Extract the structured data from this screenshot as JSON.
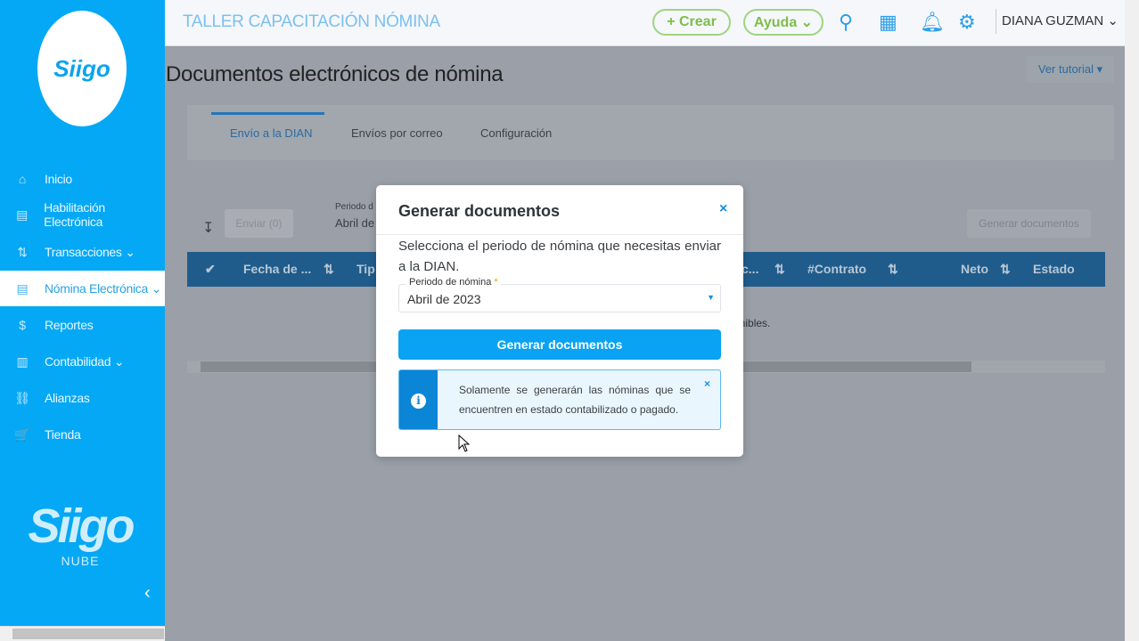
{
  "sidebar": {
    "logo": "Siigo",
    "items": [
      {
        "label": "Inicio",
        "icon": "home-icon"
      },
      {
        "label": "Habilitación Electrónica",
        "icon": "document-icon"
      },
      {
        "label": "Transacciones ⌄",
        "icon": "transactions-icon"
      },
      {
        "label": "Nómina Electrónica ⌄",
        "icon": "payroll-icon"
      },
      {
        "label": "Reportes",
        "icon": "dollar-icon"
      },
      {
        "label": "Contabilidad ⌄",
        "icon": "ledger-icon"
      },
      {
        "label": "Alianzas",
        "icon": "link-icon"
      },
      {
        "label": "Tienda",
        "icon": "cart-icon"
      }
    ],
    "brand": "Siigo",
    "brand_sub": "NUBE"
  },
  "header": {
    "company": "TALLER CAPACITACIÓN NÓMINA",
    "crear": "+ Crear",
    "ayuda": "Ayuda ⌄",
    "user": "DIANA GUZMAN ⌄"
  },
  "main": {
    "title": "Documentos electrónicos de nómina",
    "tutorial": "Ver tutorial ▾",
    "tabs": [
      "Envío a la DIAN",
      "Envíos por correo",
      "Configuración"
    ],
    "enviar": "Enviar (0)",
    "periodo_label": "Periodo d",
    "periodo_value": "Abril de",
    "generar": "Generar documentos",
    "columns": [
      "Fecha de ...",
      "Tip",
      "c...",
      "#Contrato",
      "Neto",
      "Estado"
    ],
    "empty": "onibles."
  },
  "modal": {
    "title": "Generar documentos",
    "close": "×",
    "text": "Selecciona el periodo de nómina que necesitas enviar a la DIAN.",
    "field_label": "Periodo de nómina",
    "required": "*",
    "field_value": "Abril de 2023",
    "button": "Generar documentos",
    "alert": "Solamente se generarán las nóminas que se encuentren en estado contabilizado o pagado.",
    "alert_close": "×"
  }
}
